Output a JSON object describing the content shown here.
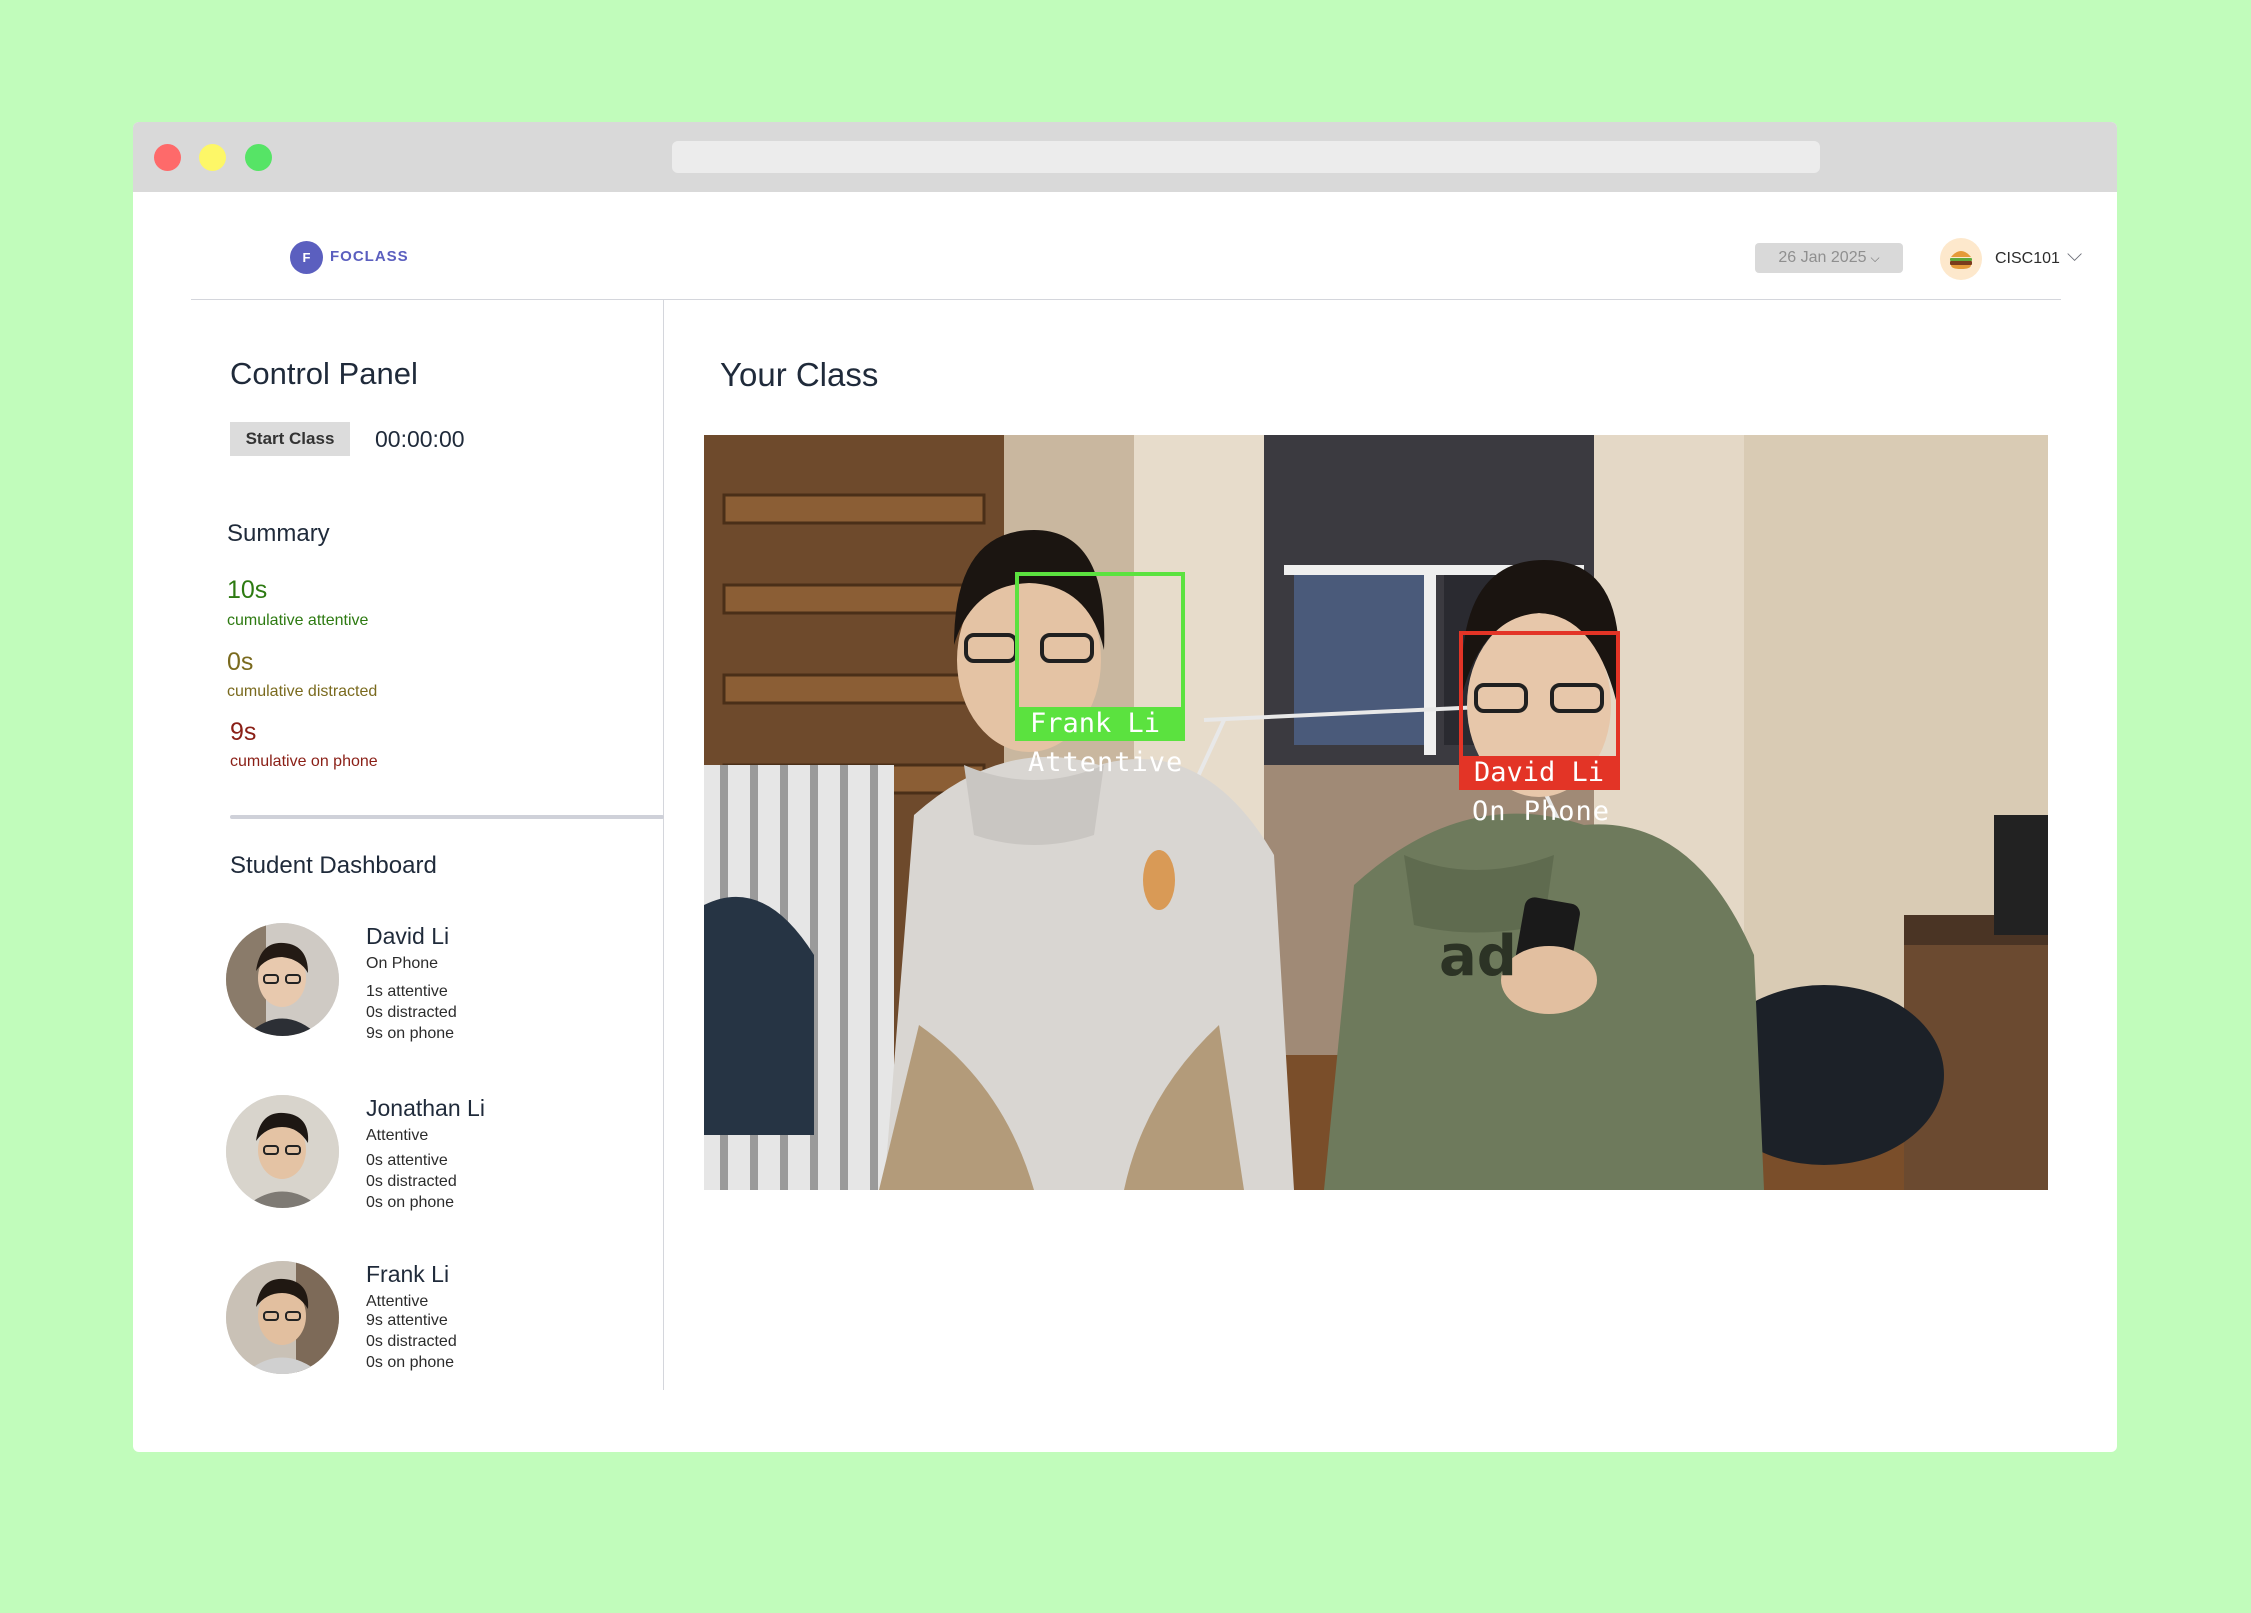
{
  "brand": {
    "logo_letter": "F",
    "name": "FOCLASS"
  },
  "header": {
    "date": "26 Jan 2025",
    "course_icon": "burger-icon",
    "course": "CISC101"
  },
  "control_panel": {
    "title": "Control Panel",
    "start_label": "Start Class",
    "timer": "00:00:00"
  },
  "summary": {
    "title": "Summary",
    "attentive_value": "10s",
    "attentive_label": "cumulative attentive",
    "distracted_value": "0s",
    "distracted_label": "cumulative distracted",
    "phone_value": "9s",
    "phone_label": "cumulative on phone"
  },
  "dashboard": {
    "title": "Student Dashboard",
    "students": [
      {
        "name": "David Li",
        "status": "On Phone",
        "attentive": "1s attentive",
        "distracted": "0s distracted",
        "phone": "9s on phone"
      },
      {
        "name": "Jonathan Li",
        "status": "Attentive",
        "attentive": "0s attentive",
        "distracted": "0s distracted",
        "phone": "0s on phone"
      },
      {
        "name": "Frank Li",
        "status": "Attentive",
        "attentive": "9s attentive",
        "distracted": "0s distracted",
        "phone": "0s on phone"
      }
    ]
  },
  "class_view": {
    "title": "Your Class",
    "detections": [
      {
        "name": "Frank Li",
        "status": "Attentive",
        "color": "#5be23f"
      },
      {
        "name": "David Li",
        "status": "On Phone",
        "color": "#e33426"
      }
    ]
  },
  "colors": {
    "background": "#c1fcbb",
    "brand": "#5b5fbf",
    "attentive": "#2d7a11",
    "distracted": "#7a6a1e",
    "phone": "#8a1f16"
  }
}
